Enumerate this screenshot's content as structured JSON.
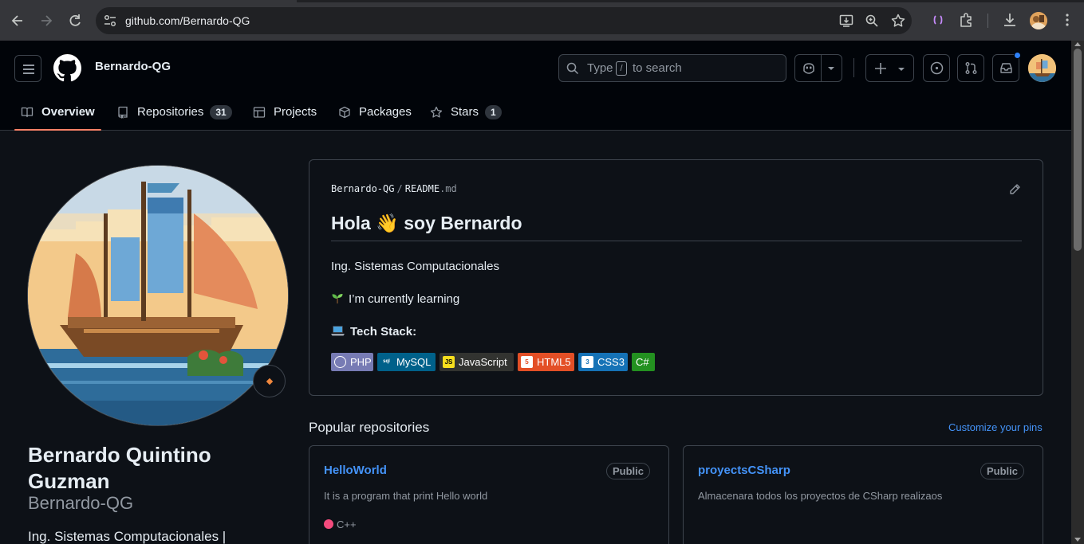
{
  "browser": {
    "url": "github.com/Bernardo-QG"
  },
  "header": {
    "user_context": "Bernardo-QG",
    "search": {
      "prefix": "Type",
      "key": "/",
      "suffix": "to search"
    },
    "plus_label": "+"
  },
  "tabs": [
    {
      "label": "Overview",
      "icon": "book-icon",
      "count": null
    },
    {
      "label": "Repositories",
      "icon": "repo-icon",
      "count": "31"
    },
    {
      "label": "Projects",
      "icon": "table-icon",
      "count": null
    },
    {
      "label": "Packages",
      "icon": "package-icon",
      "count": null
    },
    {
      "label": "Stars",
      "icon": "star-icon",
      "count": "1"
    }
  ],
  "profile": {
    "full_name": "Bernardo Quintino Guzman",
    "login": "Bernardo-QG",
    "bio": "Ing. Sistemas Computacionales |"
  },
  "readme": {
    "owner": "Bernardo-QG",
    "file": "README",
    "ext": ".md",
    "heading": "Hola 👋 soy Bernardo",
    "line1": "Ing. Sistemas Computacionales",
    "line2": "I’m currently learning",
    "line3": "Tech Stack:",
    "badges": [
      {
        "label": "PHP",
        "bg": "#777bb4"
      },
      {
        "label": "MySQL",
        "bg": "#00618a"
      },
      {
        "label": "JavaScript",
        "bg": "#323330"
      },
      {
        "label": "HTML5",
        "bg": "#e34f26"
      },
      {
        "label": "CSS3",
        "bg": "#1572b6"
      },
      {
        "label": "C#",
        "bg": "#239120"
      }
    ]
  },
  "popular": {
    "title": "Popular repositories",
    "customize": "Customize your pins",
    "repos": [
      {
        "name": "HelloWorld",
        "visibility": "Public",
        "description": "It is a program that print Hello world",
        "language": "C++",
        "lang_color": "#f34b7d"
      },
      {
        "name": "proyectsCSharp",
        "visibility": "Public",
        "description": "Almacenara todos los proyectos de CSharp realizaos",
        "language": "",
        "lang_color": ""
      }
    ]
  },
  "colors": {
    "accent_link": "#4493f8",
    "tab_underline": "#f78166",
    "notification": "#2f81f7"
  }
}
